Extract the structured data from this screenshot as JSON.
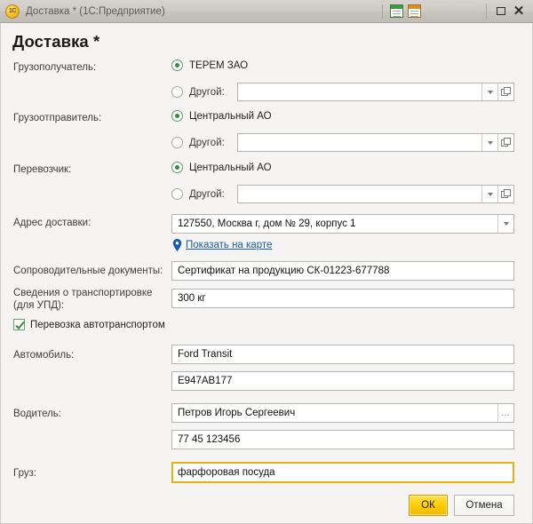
{
  "window": {
    "title": "Доставка * (1С:Предприятие)",
    "app_icon": "1c-logo-icon",
    "buttons": {
      "restore": "restore-icon",
      "close": "close-icon"
    },
    "toolbar_icons": [
      "spreadsheet-green-icon",
      "spreadsheet-orange-icon"
    ]
  },
  "dialog": {
    "title": "Доставка *",
    "rows": {
      "consignee": {
        "label": "Грузополучатель:",
        "option_primary": "ТЕРЕМ ЗАО",
        "option_primary_selected": true,
        "option_other": "Другой:",
        "option_other_selected": false,
        "other_value": "",
        "other_placeholder": ""
      },
      "consignor": {
        "label": "Грузоотправитель:",
        "option_primary": "Центральный АО",
        "option_primary_selected": true,
        "option_other": "Другой:",
        "option_other_selected": false,
        "other_value": "",
        "other_placeholder": ""
      },
      "carrier": {
        "label": "Перевозчик:",
        "option_primary": "Центральный АО",
        "option_primary_selected": true,
        "option_other": "Другой:",
        "option_other_selected": false,
        "other_value": "",
        "other_placeholder": ""
      },
      "delivery_address": {
        "label": "Адрес доставки:",
        "value": "127550, Москва г, дом № 29, корпус 1",
        "map_link": "Показать на карте"
      },
      "documents": {
        "label": "Сопроводительные документы:",
        "value": "Сертификат на продукцию СК-01223-677788"
      },
      "transport_info": {
        "label_line1": "Сведения о транспортировке",
        "label_line2": "(для УПД):",
        "value": "300 кг"
      },
      "road_transport": {
        "label": "Перевозка автотранспортом",
        "checked": true
      },
      "vehicle": {
        "label": "Автомобиль:",
        "value": "Ford Transit",
        "plate_value": "E947AB177"
      },
      "driver": {
        "label": "Водитель:",
        "value": "Петров Игорь Сергеевич",
        "license_value": "77 45 123456"
      },
      "cargo": {
        "label": "Груз:",
        "value": "фарфоровая посуда",
        "focused": true
      }
    },
    "footer": {
      "ok": "ОК",
      "cancel": "Отмена"
    }
  },
  "colors": {
    "accent_yellow": "#fdd006",
    "focus_border": "#e8b20e",
    "link_blue": "#1a5dab",
    "radio_green": "#2f8f3d",
    "check_green": "#2f8f3d"
  }
}
